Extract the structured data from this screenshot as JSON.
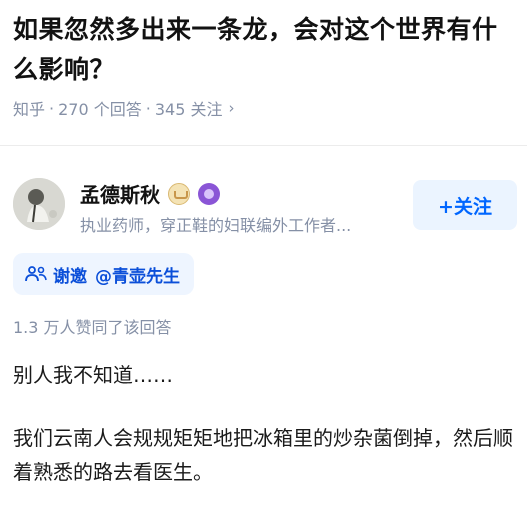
{
  "question": {
    "title": "如果忽然多出来一条龙，会对这个世界有什么影响？"
  },
  "meta": {
    "site": "知乎",
    "separator": "·",
    "answers": "270 个回答",
    "followers": "345 关注",
    "chevron_icon": "chevron-right-icon"
  },
  "author": {
    "name": "孟德斯秋",
    "bio": "执业药师，穿正鞋的妇联编外工作者...",
    "badges": [
      "gold-badge-icon",
      "purple-badge-icon"
    ],
    "colors": {
      "gold": "#d9b871",
      "purple": "#8a55d6"
    }
  },
  "follow": {
    "label": "+关注",
    "color": "#0066ff"
  },
  "invite": {
    "label": "谢邀",
    "mention": "@青壶先生",
    "icon": "invite-people-icon"
  },
  "likes": {
    "text": "1.3 万人赞同了该回答"
  },
  "answer": {
    "paragraphs": [
      "别人我不知道……",
      "我们云南人会规规矩矩地把冰箱里的炒杂菌倒掉，然后顺着熟悉的路去看医生。"
    ]
  }
}
